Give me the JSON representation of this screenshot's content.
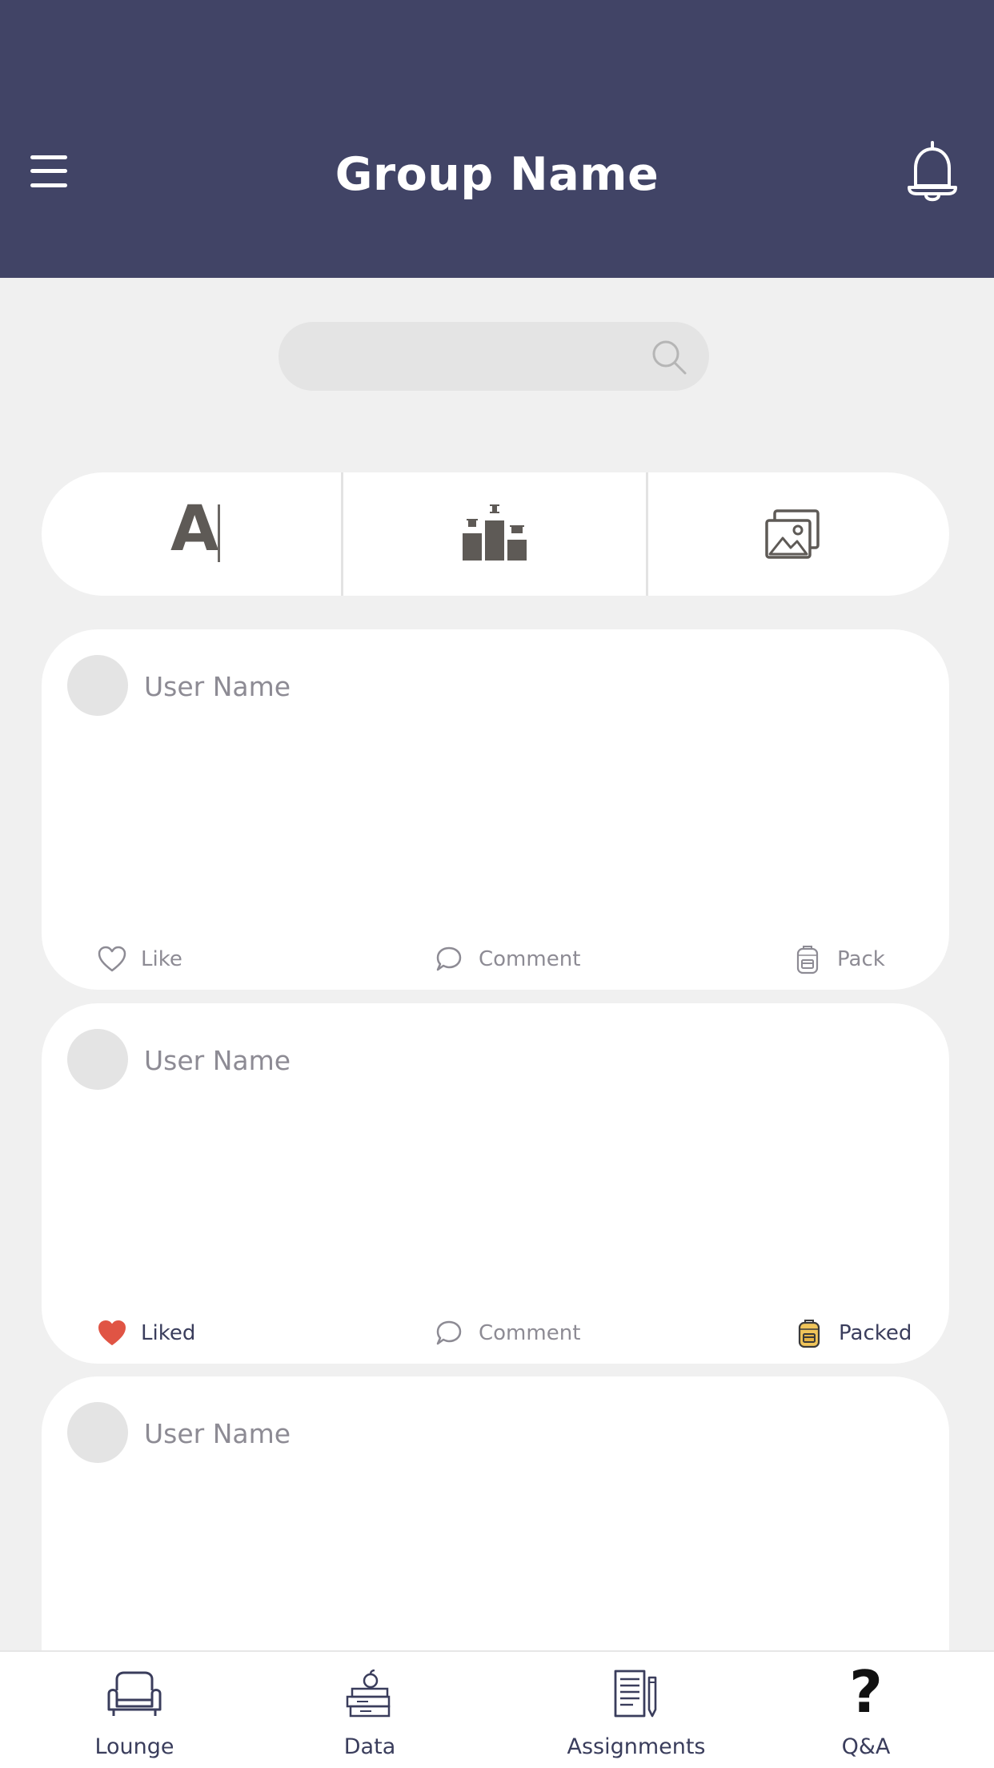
{
  "header": {
    "title": "Group Name",
    "background": "#414466",
    "menu_icon": "hamburger-menu-icon",
    "notification_icon": "bell-icon"
  },
  "search": {
    "value": "",
    "icon": "search-icon"
  },
  "composer": {
    "options": [
      {
        "icon": "text-post-icon",
        "glyph": "A"
      },
      {
        "icon": "podium-ranking-icon"
      },
      {
        "icon": "image-gallery-icon"
      }
    ]
  },
  "posts": [
    {
      "user_name": "User Name",
      "like_label": "Like",
      "comment_label": "Comment",
      "pack_label": "Pack",
      "liked": false,
      "packed": false
    },
    {
      "user_name": "User Name",
      "like_label": "Liked",
      "comment_label": "Comment",
      "pack_label": "Packed",
      "liked": true,
      "packed": true
    },
    {
      "user_name": "User Name"
    }
  ],
  "colors": {
    "liked_heart": "#e05444",
    "packed_backpack": "#f0c55a",
    "icon_gray": "#8d8b94",
    "nav_text": "#3a3d5c"
  },
  "bottom_nav": {
    "items": [
      {
        "label": "Lounge",
        "icon": "armchair-icon"
      },
      {
        "label": "Data",
        "icon": "books-apple-icon"
      },
      {
        "label": "Assignments",
        "icon": "document-pencil-icon"
      },
      {
        "label": "Q&A",
        "icon": "question-mark-icon"
      }
    ]
  }
}
